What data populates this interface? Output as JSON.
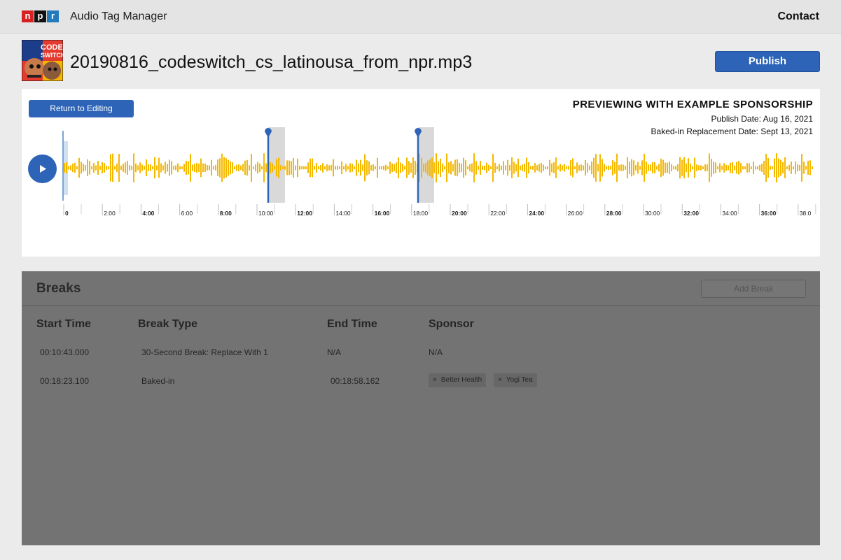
{
  "app": {
    "logo_letters": [
      "n",
      "p",
      "r"
    ],
    "title": "Audio Tag Manager",
    "contact_label": "Contact"
  },
  "file": {
    "name": "20190816_codeswitch_cs_latinousa_from_npr.mp3",
    "cover_text": [
      "CODE",
      "SWITCH"
    ],
    "publish_label": "Publish"
  },
  "editor": {
    "return_label": "Return to Editing",
    "preview_title": "PREVIEWING WITH EXAMPLE SPONSORSHIP",
    "publish_date": "Publish Date: Aug 16, 2021",
    "replacement_date": "Baked-in Replacement Date: Sept 13, 2021",
    "play_icon": "play-icon",
    "wave_color": "#f5b800",
    "accent_color": "#2d64b7",
    "timeline_ticks": [
      "0",
      "2:00",
      "4:00",
      "6:00",
      "8:00",
      "10:00",
      "12:00",
      "14:00",
      "16:00",
      "18:00",
      "20:00",
      "22:00",
      "24:00",
      "26:00",
      "28:00",
      "30:00",
      "32:00",
      "34:00",
      "36:00",
      "38:0"
    ]
  },
  "breaks": {
    "title": "Breaks",
    "add_label": "Add Break",
    "columns": [
      "Start Time",
      "Break Type",
      "End Time",
      "Sponsor"
    ],
    "rows": [
      {
        "start": "00:10:43.000",
        "type": "30-Second Break: Replace With 1",
        "end": "N/A",
        "sponsor": "N/A",
        "chips": []
      },
      {
        "start": "00:18:23.100",
        "type": "Baked-in",
        "end": "00:18:58.162",
        "sponsor": "",
        "chips": [
          "Better Health",
          "Yogi Tea"
        ]
      }
    ]
  }
}
